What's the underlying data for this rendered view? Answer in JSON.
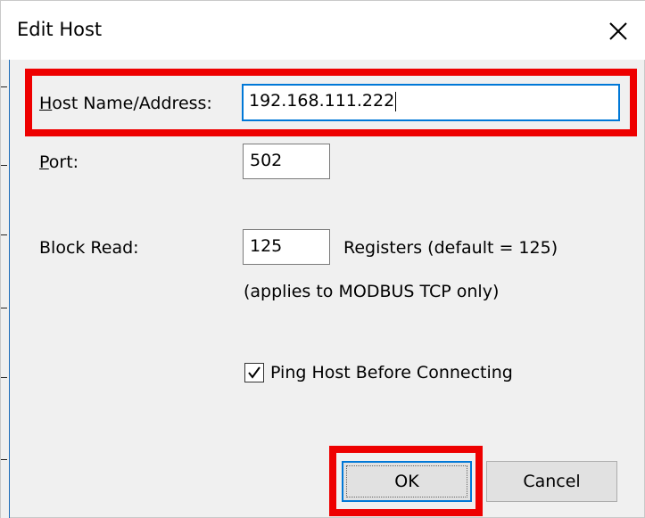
{
  "dialog": {
    "title": "Edit Host",
    "close_icon": "close-icon"
  },
  "host": {
    "label_access": "H",
    "label_rest": "ost Name/Address:",
    "value": "192.168.111.222"
  },
  "port": {
    "label_access": "P",
    "label_rest": "ort:",
    "value": "502"
  },
  "block_read": {
    "label": "Block Read:",
    "value": "125",
    "units": "Registers (default = 125)",
    "note": "(applies to MODBUS TCP only)"
  },
  "ping": {
    "label": "Ping Host Before Connecting",
    "checked": true
  },
  "buttons": {
    "ok": "OK",
    "cancel": "Cancel"
  },
  "colors": {
    "highlight": "#ee0000",
    "focus": "#0078d7"
  }
}
